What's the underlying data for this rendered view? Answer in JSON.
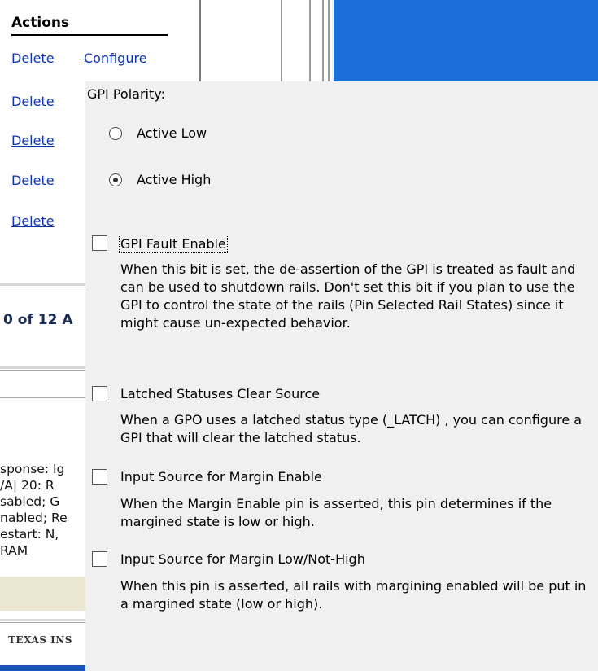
{
  "background": {
    "actions_title": "Actions",
    "delete_label": "Delete",
    "configure_label": "Configure",
    "count_text": "0 of 12 A",
    "side_lines": [
      "sponse: Ig",
      "/A| 20: R",
      "sabled; G",
      "nabled; Re",
      "estart: N,",
      "RAM"
    ],
    "company_text": "TEXAS INS"
  },
  "dialog": {
    "polarity_label": "GPI Polarity:",
    "radio_options": [
      {
        "label": "Active Low",
        "selected": false
      },
      {
        "label": "Active High",
        "selected": true
      }
    ],
    "options": [
      {
        "label": "GPI Fault Enable",
        "checked": false,
        "description": "When this bit is set, the de-assertion of the GPI is treated as fault and can be used to shutdown rails. Don't set this bit if you plan to use the GPI to control the state of the rails (Pin Selected Rail States) since it might cause un-expected behavior."
      },
      {
        "label": "Latched Statuses Clear Source",
        "checked": false,
        "description": "When a GPO uses a latched status type (_LATCH) , you can configure a GPI that will clear the latched status."
      },
      {
        "label": "Input Source for Margin Enable",
        "checked": false,
        "description": "When the Margin Enable pin is asserted, this pin determines if the margined state is low or high."
      },
      {
        "label": "Input Source for Margin Low/Not-High",
        "checked": false,
        "description": "When this pin is asserted, all rails with margining enabled will be put in a margined state (low or high)."
      }
    ]
  },
  "colors": {
    "link": "#1133aa",
    "title_bar_blue": "#1a6fd9"
  }
}
